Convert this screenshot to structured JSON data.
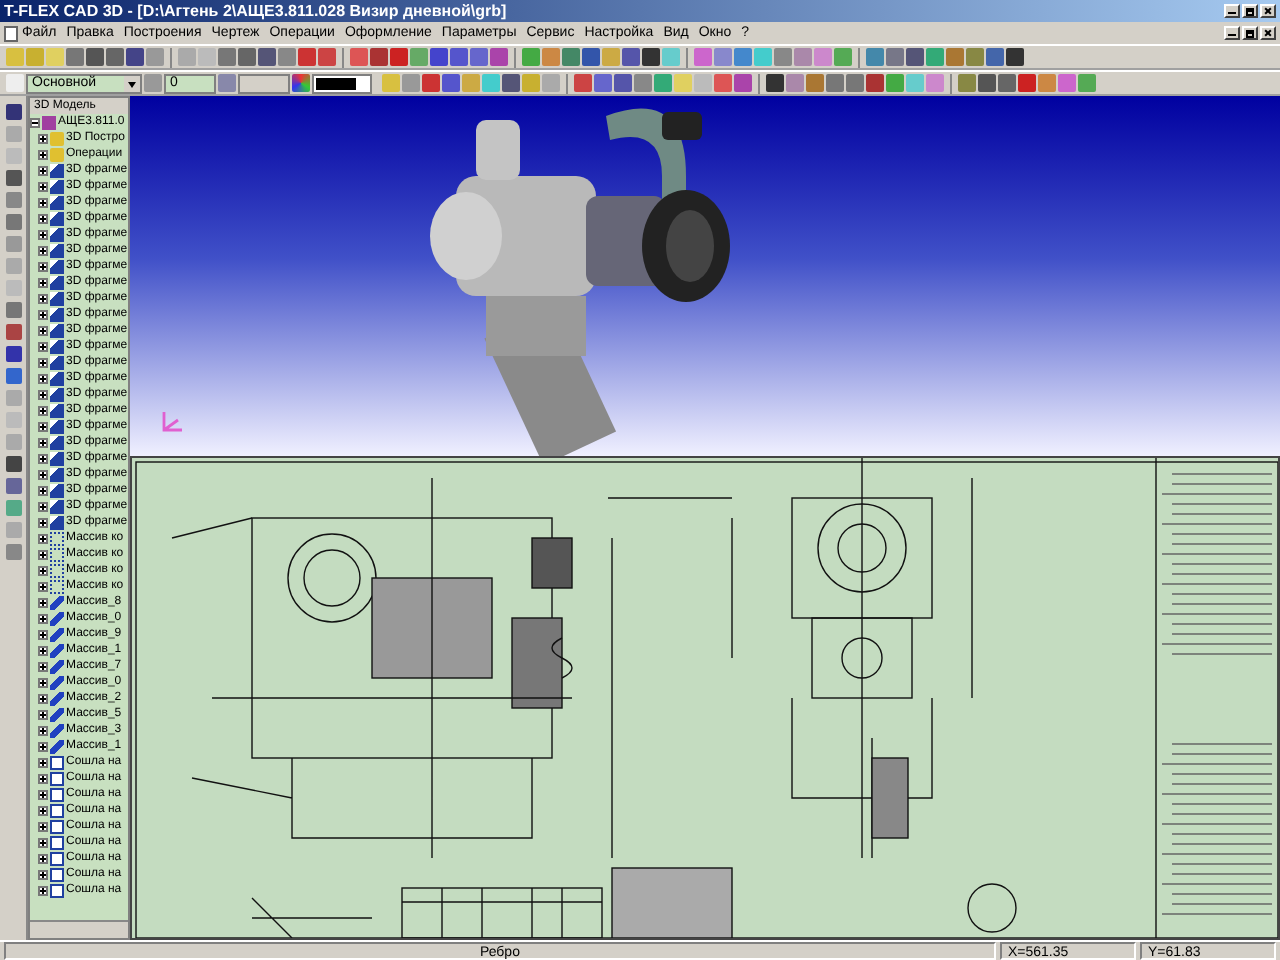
{
  "window": {
    "title": "T-FLEX CAD 3D - [D:\\Агтень 2\\АЩЕ3.811.028 Визир дневной\\grb]"
  },
  "menu": [
    "Файл",
    "Правка",
    "Построения",
    "Чертеж",
    "Операции",
    "Оформление",
    "Параметры",
    "Сервис",
    "Настройка",
    "Вид",
    "Окно",
    "?"
  ],
  "properties_bar": {
    "layer": "Основной",
    "level": "0"
  },
  "tree": {
    "header": "3D Модель",
    "items": [
      {
        "label": "АЩЕ3.811.0",
        "kind": "model",
        "expanded": true,
        "children": [
          {
            "label": "3D Постро",
            "kind": "folder",
            "expanded": false
          },
          {
            "label": "Операции",
            "kind": "folder",
            "expanded": false
          },
          {
            "label": "3D фрагме",
            "kind": "fragment",
            "expanded": false
          },
          {
            "label": "3D фрагме",
            "kind": "fragment",
            "expanded": false
          },
          {
            "label": "3D фрагме",
            "kind": "fragment",
            "expanded": false
          },
          {
            "label": "3D фрагме",
            "kind": "fragment",
            "expanded": false
          },
          {
            "label": "3D фрагме",
            "kind": "fragment",
            "expanded": false
          },
          {
            "label": "3D фрагме",
            "kind": "fragment",
            "expanded": false
          },
          {
            "label": "3D фрагме",
            "kind": "fragment",
            "expanded": false
          },
          {
            "label": "3D фрагме",
            "kind": "fragment",
            "expanded": false
          },
          {
            "label": "3D фрагме",
            "kind": "fragment",
            "expanded": false
          },
          {
            "label": "3D фрагме",
            "kind": "fragment",
            "expanded": false
          },
          {
            "label": "3D фрагме",
            "kind": "fragment",
            "expanded": false
          },
          {
            "label": "3D фрагме",
            "kind": "fragment",
            "expanded": false
          },
          {
            "label": "3D фрагме",
            "kind": "fragment",
            "expanded": false
          },
          {
            "label": "3D фрагме",
            "kind": "fragment",
            "expanded": false
          },
          {
            "label": "3D фрагме",
            "kind": "fragment",
            "expanded": false
          },
          {
            "label": "3D фрагме",
            "kind": "fragment",
            "expanded": false
          },
          {
            "label": "3D фрагме",
            "kind": "fragment",
            "expanded": false
          },
          {
            "label": "3D фрагме",
            "kind": "fragment",
            "expanded": false
          },
          {
            "label": "3D фрагме",
            "kind": "fragment",
            "expanded": false
          },
          {
            "label": "3D фрагме",
            "kind": "fragment",
            "expanded": false
          },
          {
            "label": "3D фрагме",
            "kind": "fragment",
            "expanded": false
          },
          {
            "label": "3D фрагме",
            "kind": "fragment",
            "expanded": false
          },
          {
            "label": "3D фрагме",
            "kind": "fragment",
            "expanded": false
          },
          {
            "label": "Массив ко",
            "kind": "pattern",
            "expanded": false
          },
          {
            "label": "Массив ко",
            "kind": "pattern",
            "expanded": false
          },
          {
            "label": "Массив ко",
            "kind": "pattern",
            "expanded": false
          },
          {
            "label": "Массив ко",
            "kind": "pattern",
            "expanded": false
          },
          {
            "label": "Массив_8",
            "kind": "array",
            "expanded": false
          },
          {
            "label": "Массив_0",
            "kind": "array",
            "expanded": false
          },
          {
            "label": "Массив_9",
            "kind": "array",
            "expanded": false
          },
          {
            "label": "Массив_1",
            "kind": "array",
            "expanded": false
          },
          {
            "label": "Массив_7",
            "kind": "array",
            "expanded": false
          },
          {
            "label": "Массив_0",
            "kind": "array",
            "expanded": false
          },
          {
            "label": "Массив_2",
            "kind": "array",
            "expanded": false
          },
          {
            "label": "Массив_5",
            "kind": "array",
            "expanded": false
          },
          {
            "label": "Массив_3",
            "kind": "array",
            "expanded": false
          },
          {
            "label": "Массив_1",
            "kind": "array",
            "expanded": false
          },
          {
            "label": "Сошла на",
            "kind": "mate",
            "expanded": false
          },
          {
            "label": "Сошла на",
            "kind": "mate",
            "expanded": false
          },
          {
            "label": "Сошла на",
            "kind": "mate",
            "expanded": false
          },
          {
            "label": "Сошла на",
            "kind": "mate",
            "expanded": false
          },
          {
            "label": "Сошла на",
            "kind": "mate",
            "expanded": false
          },
          {
            "label": "Сошла на",
            "kind": "mate",
            "expanded": false
          },
          {
            "label": "Сошла на",
            "kind": "mate",
            "expanded": false
          },
          {
            "label": "Сошла на",
            "kind": "mate",
            "expanded": false
          },
          {
            "label": "Сошла на",
            "kind": "mate",
            "expanded": false
          }
        ]
      }
    ]
  },
  "status_bar": {
    "hint": "Ребро",
    "x": "X=561.35",
    "y": "Y=61.83"
  }
}
